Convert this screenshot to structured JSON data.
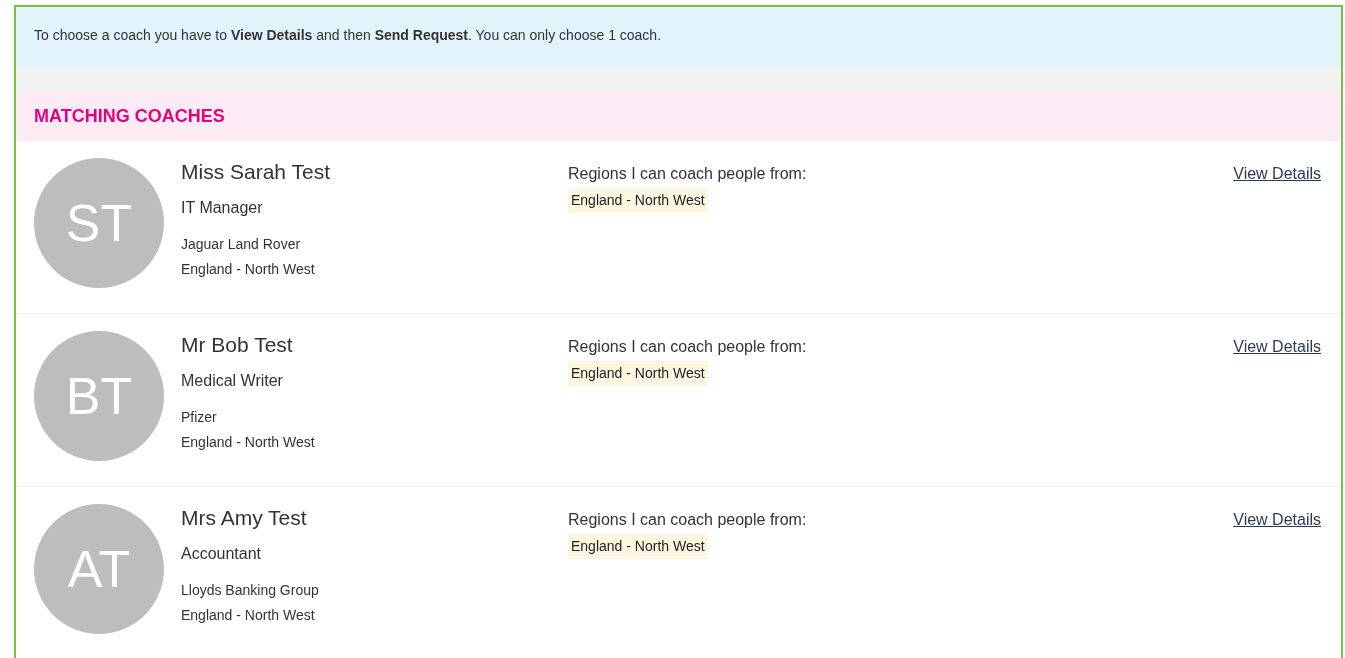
{
  "notice": "To choose a coach you have to **View Details** and then **Send Request**. You can only choose 1 coach.",
  "section_title": "MATCHING COACHES",
  "coaches": [
    {
      "initials": "ST",
      "name": "Miss Sarah Test",
      "job_title": "IT Manager",
      "company": "Jaguar Land Rover",
      "location": "England - North West",
      "regions_label": "Regions I can coach people from:",
      "regions": [
        "England - North West"
      ],
      "link": "View Details"
    },
    {
      "initials": "BT",
      "name": "Mr Bob Test",
      "job_title": "Medical Writer",
      "company": "Pfizer",
      "location": "England - North West",
      "regions_label": "Regions I can coach people from:",
      "regions": [
        "England - North West"
      ],
      "link": "View Details"
    },
    {
      "initials": "AT",
      "name": "Mrs Amy Test",
      "job_title": "Accountant",
      "company": "Lloyds Banking Group",
      "location": "England - North West",
      "regions_label": "Regions I can coach people from:",
      "regions": [
        "England - North West"
      ],
      "link": "View Details"
    }
  ]
}
